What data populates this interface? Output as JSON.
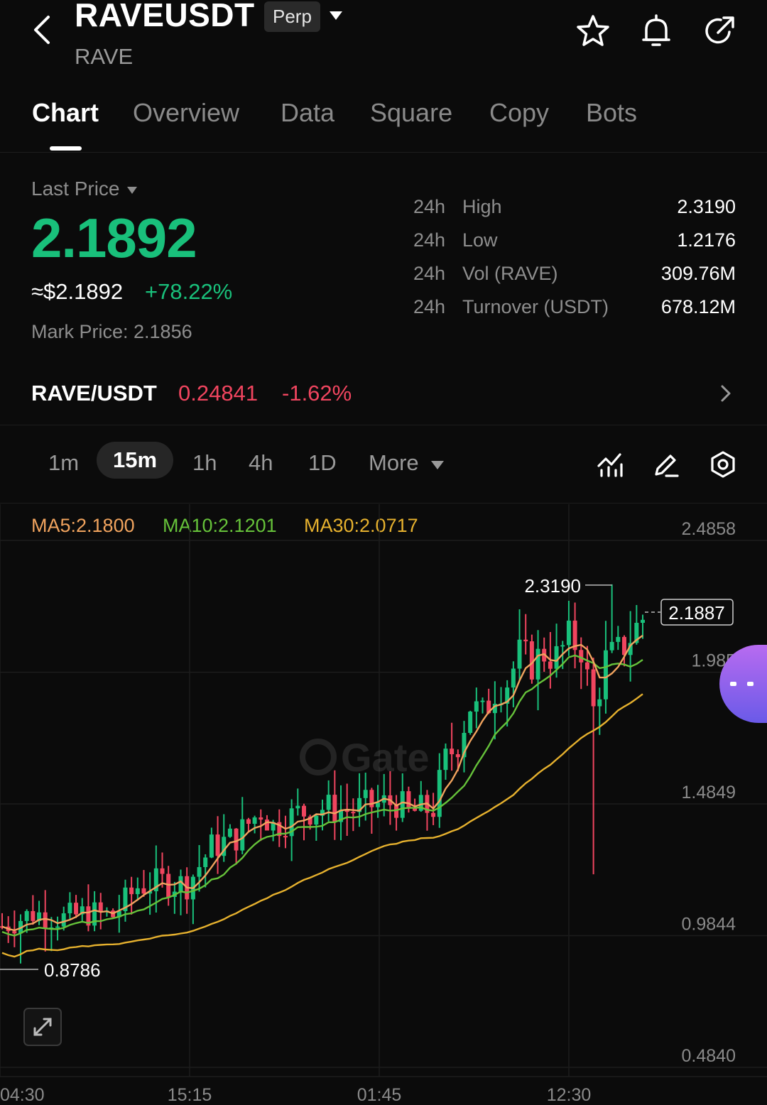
{
  "header": {
    "symbol": "RAVEUSDT",
    "contract_type": "Perp",
    "base_asset": "RAVE"
  },
  "tabs": [
    {
      "label": "Chart",
      "active": true
    },
    {
      "label": "Overview",
      "active": false
    },
    {
      "label": "Data",
      "active": false
    },
    {
      "label": "Square",
      "active": false
    },
    {
      "label": "Copy",
      "active": false
    },
    {
      "label": "Bots",
      "active": false
    }
  ],
  "price": {
    "label": "Last Price",
    "last": "2.1892",
    "usd": "≈$2.1892",
    "change": "+78.22%",
    "mark": "Mark Price: 2.1856"
  },
  "stats": [
    {
      "period": "24h",
      "key": "High",
      "value": "2.3190"
    },
    {
      "period": "24h",
      "key": "Low",
      "value": "1.2176"
    },
    {
      "period": "24h",
      "key": "Vol (RAVE)",
      "value": "309.76M"
    },
    {
      "period": "24h",
      "key": "Turnover (USDT)",
      "value": "678.12M"
    }
  ],
  "spot": {
    "pair": "RAVE/USDT",
    "price": "0.24841",
    "change": "-1.62%"
  },
  "intervals": [
    {
      "label": "1m",
      "active": false
    },
    {
      "label": "15m",
      "active": true
    },
    {
      "label": "1h",
      "active": false
    },
    {
      "label": "4h",
      "active": false
    },
    {
      "label": "1D",
      "active": false
    }
  ],
  "more_label": "More",
  "ma_legend": {
    "ma5": "MA5:2.1800",
    "ma10": "MA10:2.1201",
    "ma30": "MA30:2.0717"
  },
  "colors": {
    "up": "#19c07b",
    "down": "#f0455f",
    "ma5": "#f0a35e",
    "ma10": "#66c23a",
    "ma30": "#e6b12e"
  },
  "chart_data": {
    "type": "candlestick",
    "interval": "15m",
    "y_ticks": [
      "2.4858",
      "1.985",
      "1.4849",
      "0.9844",
      "0.4840"
    ],
    "x_ticks": [
      "04:30",
      "15:15",
      "01:45",
      "12:30"
    ],
    "ylim": [
      0.484,
      2.4858
    ],
    "high_label": "2.3190",
    "low_label": "0.8786",
    "current_label": "2.1887",
    "close_path": [
      [
        0,
        1.02
      ],
      [
        5,
        1.07
      ],
      [
        10,
        1.05
      ],
      [
        14,
        1.07
      ],
      [
        18,
        1.06
      ],
      [
        22,
        1.17
      ],
      [
        26,
        1.19
      ],
      [
        30,
        1.18
      ],
      [
        34,
        1.32
      ],
      [
        38,
        1.36
      ],
      [
        42,
        1.46
      ],
      [
        44,
        1.4
      ],
      [
        48,
        1.45
      ],
      [
        52,
        1.47
      ],
      [
        56,
        1.46
      ],
      [
        60,
        1.48
      ],
      [
        64,
        1.49
      ],
      [
        66,
        1.45
      ],
      [
        70,
        1.47
      ],
      [
        72,
        1.65
      ],
      [
        74,
        1.72
      ],
      [
        76,
        1.86
      ],
      [
        78,
        1.82
      ],
      [
        80,
        1.92
      ],
      [
        82,
        1.95
      ],
      [
        84,
        2.05
      ],
      [
        86,
        2.02
      ],
      [
        88,
        2.06
      ],
      [
        90,
        2.04
      ],
      [
        92,
        2.11
      ],
      [
        94,
        2.08
      ],
      [
        96,
        1.84
      ],
      [
        98,
        2.03
      ],
      [
        100,
        2.06
      ],
      [
        102,
        2.12
      ],
      [
        104,
        2.19
      ]
    ],
    "grid": true
  }
}
